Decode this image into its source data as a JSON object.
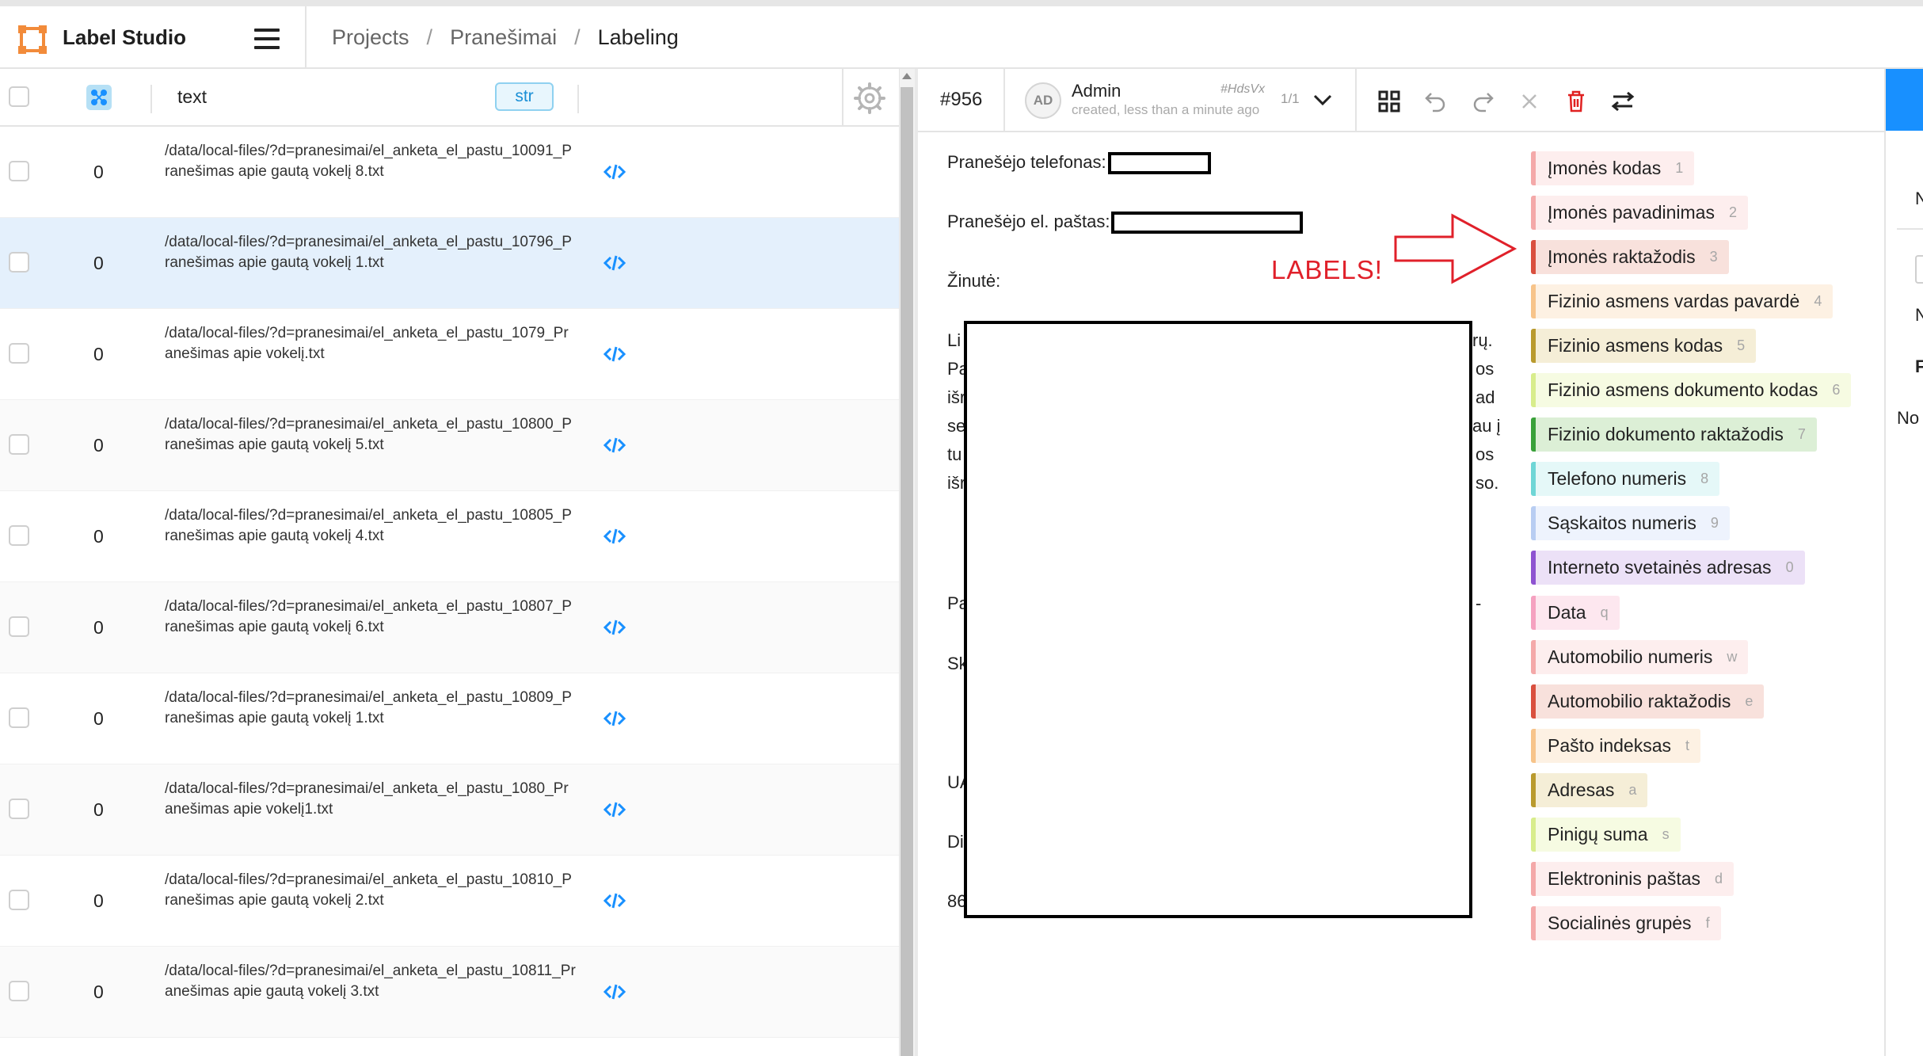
{
  "header": {
    "app_title": "Label Studio",
    "breadcrumb": [
      "Projects",
      "Pranešimai",
      "Labeling"
    ],
    "separator": "/"
  },
  "table": {
    "column_text": "text",
    "column_type": "str",
    "rows": [
      {
        "count": "0",
        "path": "/data/local-files/?d=pranesimai/el_anketa_el_pastu_10091_Pranešimas apie gautą vokelį 8.txt",
        "selected": false
      },
      {
        "count": "0",
        "path": "/data/local-files/?d=pranesimai/el_anketa_el_pastu_10796_Pranešimas apie gautą vokelį 1.txt",
        "selected": true
      },
      {
        "count": "0",
        "path": "/data/local-files/?d=pranesimai/el_anketa_el_pastu_1079_Pranešimas apie vokelį.txt",
        "selected": false
      },
      {
        "count": "0",
        "path": "/data/local-files/?d=pranesimai/el_anketa_el_pastu_10800_Pranešimas apie gautą vokelį 5.txt",
        "selected": false
      },
      {
        "count": "0",
        "path": "/data/local-files/?d=pranesimai/el_anketa_el_pastu_10805_Pranešimas apie gautą vokelį 4.txt",
        "selected": false
      },
      {
        "count": "0",
        "path": "/data/local-files/?d=pranesimai/el_anketa_el_pastu_10807_Pranešimas apie gautą vokelį 6.txt",
        "selected": false
      },
      {
        "count": "0",
        "path": "/data/local-files/?d=pranesimai/el_anketa_el_pastu_10809_Pranešimas apie gautą vokelį 1.txt",
        "selected": false
      },
      {
        "count": "0",
        "path": "/data/local-files/?d=pranesimai/el_anketa_el_pastu_1080_Pranešimas apie vokelį1.txt",
        "selected": false
      },
      {
        "count": "0",
        "path": "/data/local-files/?d=pranesimai/el_anketa_el_pastu_10810_Pranešimas apie gautą vokelį 2.txt",
        "selected": false
      },
      {
        "count": "0",
        "path": "/data/local-files/?d=pranesimai/el_anketa_el_pastu_10811_Pranešimas apie gautą vokelį 3.txt",
        "selected": false
      }
    ]
  },
  "annotation": {
    "task_id": "#956",
    "avatar": "AD",
    "user": "Admin",
    "created": "created, less than a minute ago",
    "hash": "#HdsVx",
    "count": "1/1"
  },
  "document": {
    "phone_label": "Pranešėjo telefonas:",
    "email_label": "Pranešėjo el. paštas:",
    "message_label": "Žinutė:",
    "left_fragments": [
      "Li",
      "Pa",
      "išr",
      "se",
      "tu",
      "išr",
      "Pa",
      "Sk",
      "UA",
      "Di",
      "86"
    ],
    "right_fragments": [
      "rų.",
      "os",
      "ad",
      "au į",
      "os",
      "so.",
      "-"
    ],
    "callout": "LABELS!"
  },
  "labels": [
    {
      "text": "Įmonės kodas",
      "hotkey": "1",
      "color": "#f4a9a9",
      "bg": "#fdeeee"
    },
    {
      "text": "Įmonės pavadinimas",
      "hotkey": "2",
      "color": "#f4a9a9",
      "bg": "#fdeeee"
    },
    {
      "text": "Įmonės raktažodis",
      "hotkey": "3",
      "color": "#d9503f",
      "bg": "#f8e1dc"
    },
    {
      "text": "Fizinio asmens vardas pavardė",
      "hotkey": "4",
      "color": "#f7c48a",
      "bg": "#fdf1e3"
    },
    {
      "text": "Fizinio asmens kodas",
      "hotkey": "5",
      "color": "#b99a2e",
      "bg": "#f5eed7"
    },
    {
      "text": "Fizinio asmens dokumento kodas",
      "hotkey": "6",
      "color": "#d8ed8c",
      "bg": "#f6fbe2"
    },
    {
      "text": "Fizinio dokumento raktažodis",
      "hotkey": "7",
      "color": "#3aa13a",
      "bg": "#dcefd6"
    },
    {
      "text": "Telefono numeris",
      "hotkey": "8",
      "color": "#6fd6d6",
      "bg": "#e5f8f8"
    },
    {
      "text": "Sąskaitos numeris",
      "hotkey": "9",
      "color": "#b8cdf2",
      "bg": "#eef3fd"
    },
    {
      "text": "Interneto svetainės adresas",
      "hotkey": "0",
      "color": "#8e53d1",
      "bg": "#ece1f7"
    },
    {
      "text": "Data",
      "hotkey": "q",
      "color": "#f5a1c0",
      "bg": "#fde7ef"
    },
    {
      "text": "Automobilio numeris",
      "hotkey": "w",
      "color": "#f4a9a9",
      "bg": "#fdeeee"
    },
    {
      "text": "Automobilio raktažodis",
      "hotkey": "e",
      "color": "#d9503f",
      "bg": "#f8e1dc"
    },
    {
      "text": "Pašto indeksas",
      "hotkey": "t",
      "color": "#f7c48a",
      "bg": "#fdf1e3"
    },
    {
      "text": "Adresas",
      "hotkey": "a",
      "color": "#b99a2e",
      "bg": "#f5eed7"
    },
    {
      "text": "Pinigų suma",
      "hotkey": "s",
      "color": "#d8ed8c",
      "bg": "#f6fbe2"
    },
    {
      "text": "Elektroninis paštas",
      "hotkey": "d",
      "color": "#f4a9a9",
      "bg": "#fdeeee"
    },
    {
      "text": "Socialinės grupės",
      "hotkey": "f",
      "color": "#f4a9a9",
      "bg": "#fdeeee"
    }
  ],
  "right_panel": {
    "frag1": "N",
    "frag2": "N",
    "frag3": "F",
    "frag4": "No"
  }
}
